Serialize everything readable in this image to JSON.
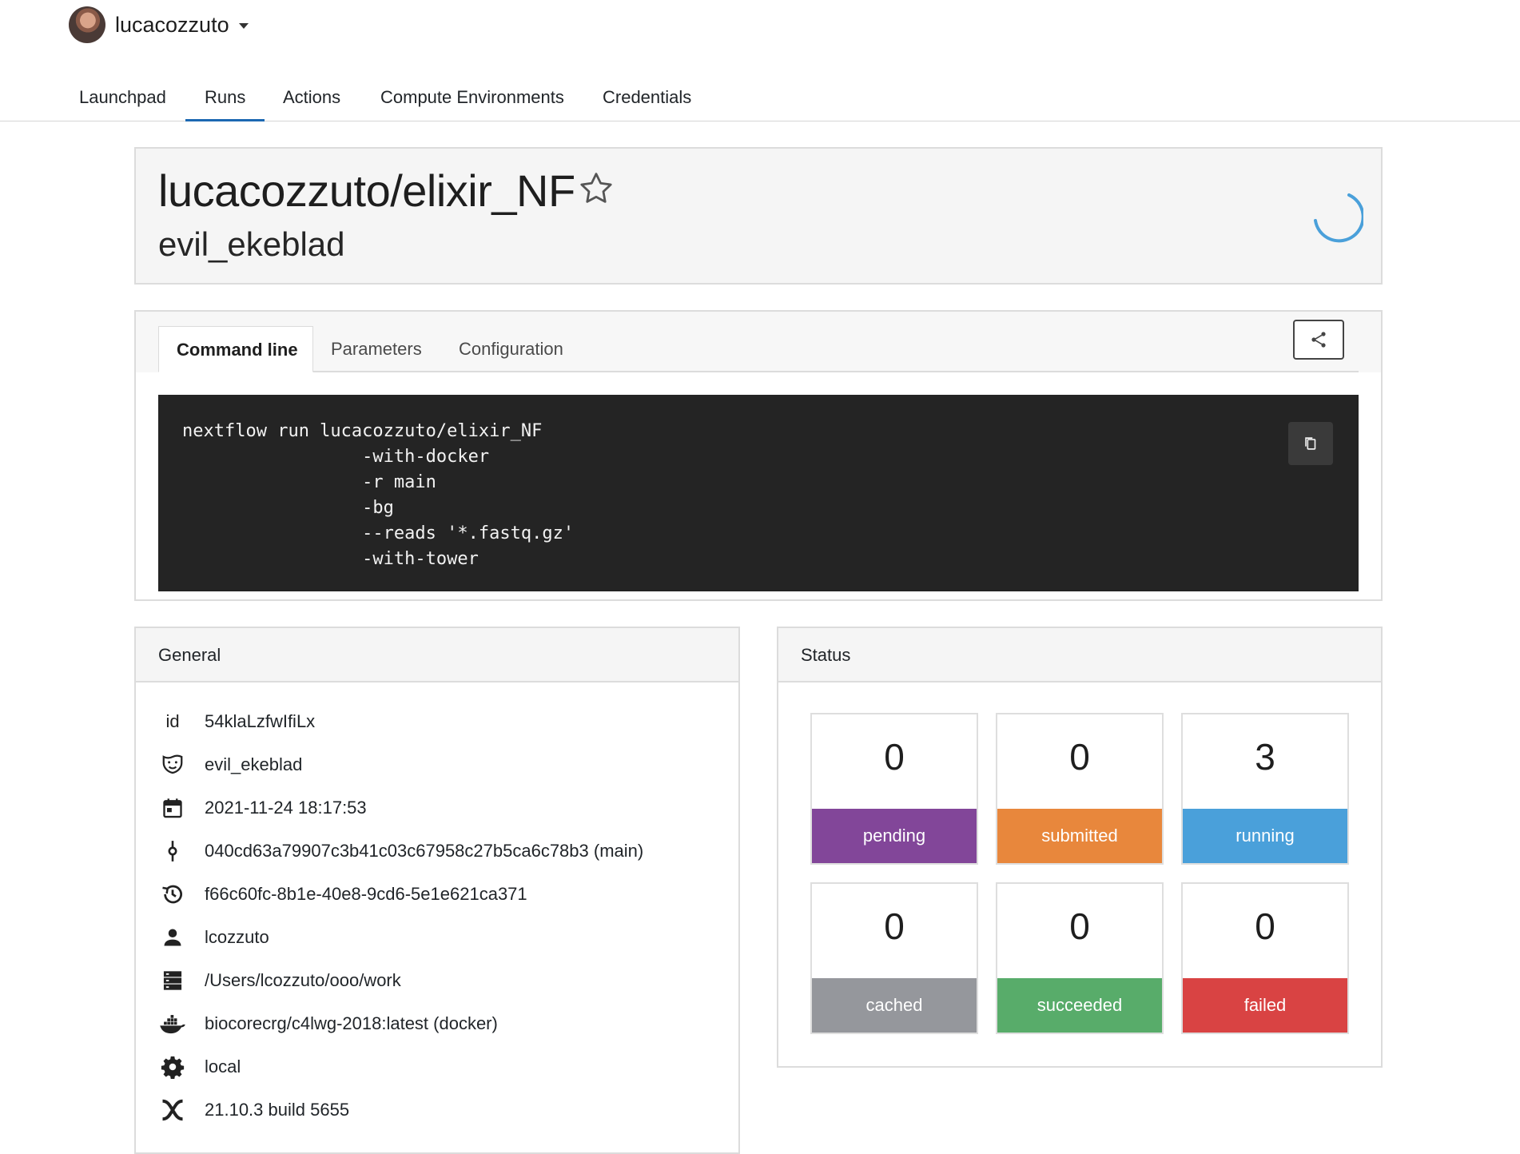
{
  "user": {
    "name": "lucacozzuto"
  },
  "nav": {
    "items": [
      "Launchpad",
      "Runs",
      "Actions",
      "Compute Environments",
      "Credentials"
    ],
    "active": "Runs"
  },
  "run": {
    "pipeline": "lucacozzuto/elixir_NF",
    "name": "evil_ekeblad"
  },
  "tabs": {
    "command_line": "Command line",
    "parameters": "Parameters",
    "configuration": "Configuration"
  },
  "command": {
    "text": "nextflow run lucacozzuto/elixir_NF\n                 -with-docker\n                 -r main\n                 -bg\n                 --reads '*.fastq.gz'\n                 -with-tower"
  },
  "general": {
    "title": "General",
    "id_label": "id",
    "rows": [
      {
        "icon": "id-label",
        "value": "54klaLzfwIfiLx"
      },
      {
        "icon": "theater-masks-icon",
        "value": "evil_ekeblad"
      },
      {
        "icon": "calendar-icon",
        "value": "2021-11-24 18:17:53"
      },
      {
        "icon": "commit-icon",
        "value": "040cd63a79907c3b41c03c67958c27b5ca6c78b3 (main)"
      },
      {
        "icon": "history-icon",
        "value": "f66c60fc-8b1e-40e8-9cd6-5e1e621ca371"
      },
      {
        "icon": "user-icon",
        "value": "lcozzuto"
      },
      {
        "icon": "server-icon",
        "value": "/Users/lcozzuto/ooo/work"
      },
      {
        "icon": "docker-icon",
        "value": "biocorecrg/c4lwg-2018:latest (docker)"
      },
      {
        "icon": "gear-icon",
        "value": "local"
      },
      {
        "icon": "nextflow-icon",
        "value": "21.10.3 build 5655"
      }
    ]
  },
  "status": {
    "title": "Status",
    "items": [
      {
        "label": "pending",
        "count": "0",
        "color": "#824699"
      },
      {
        "label": "submitted",
        "count": "0",
        "color": "#e8873c"
      },
      {
        "label": "running",
        "count": "3",
        "color": "#4aa0da"
      },
      {
        "label": "cached",
        "count": "0",
        "color": "#95979c"
      },
      {
        "label": "succeeded",
        "count": "0",
        "color": "#58ac6a"
      },
      {
        "label": "failed",
        "count": "0",
        "color": "#d94343"
      }
    ]
  }
}
